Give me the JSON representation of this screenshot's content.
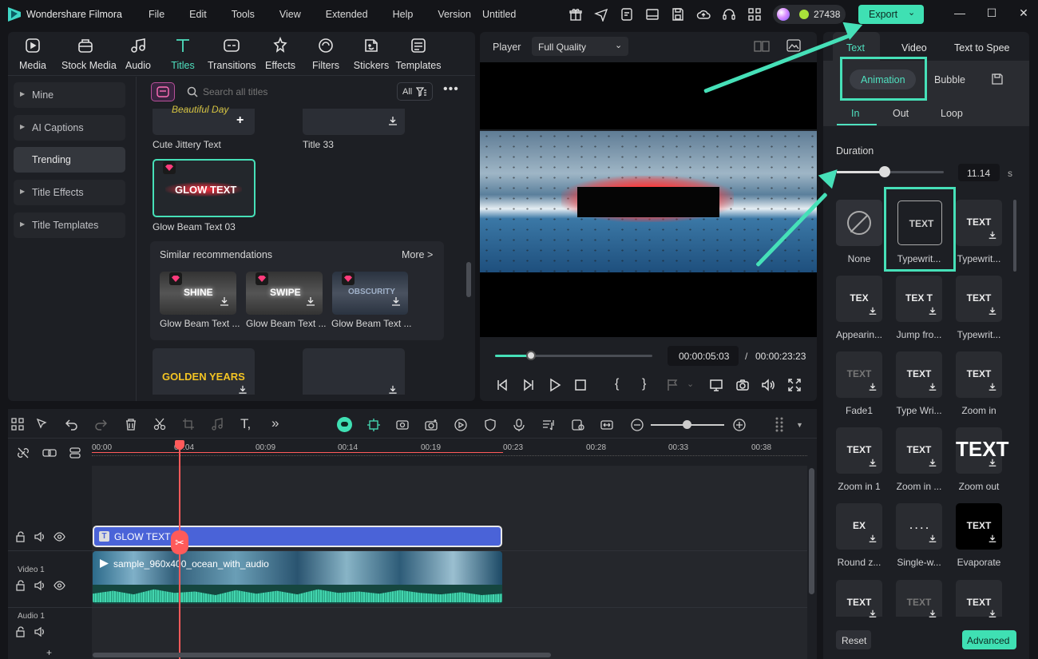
{
  "app": {
    "name": "Wondershare Filmora",
    "doc_title": "Untitled",
    "credits": "27438",
    "export_label": "Export"
  },
  "menu": [
    "File",
    "Edit",
    "Tools",
    "View",
    "Extended",
    "Help",
    "Version"
  ],
  "toolbar": [
    {
      "label": "Media",
      "icon": "media-icon"
    },
    {
      "label": "Stock Media",
      "icon": "stock-media-icon"
    },
    {
      "label": "Audio",
      "icon": "audio-icon"
    },
    {
      "label": "Titles",
      "icon": "titles-icon",
      "active": true
    },
    {
      "label": "Transitions",
      "icon": "transitions-icon"
    },
    {
      "label": "Effects",
      "icon": "effects-icon"
    },
    {
      "label": "Filters",
      "icon": "filters-icon"
    },
    {
      "label": "Stickers",
      "icon": "stickers-icon"
    },
    {
      "label": "Templates",
      "icon": "templates-icon"
    }
  ],
  "sidebar": [
    {
      "label": "Mine",
      "arrow": true
    },
    {
      "label": "AI Captions",
      "arrow": true
    },
    {
      "label": "Trending",
      "arrow": false,
      "active": true
    },
    {
      "label": "Title Effects",
      "arrow": true
    },
    {
      "label": "Title Templates",
      "arrow": true
    }
  ],
  "library": {
    "search_placeholder": "Search all titles",
    "filter_label": "All",
    "thumb_top_left_text": "Beautiful Day",
    "items": [
      {
        "caption": "Cute Jittery Text"
      },
      {
        "caption": "Title 33"
      },
      {
        "caption": "Glow Beam Text 03",
        "thumb_text": "GLOW TEXT"
      }
    ],
    "similar": {
      "title": "Similar recommendations",
      "more": "More >",
      "items": [
        {
          "caption": "Glow Beam Text ...",
          "thumb_text": "SHINE"
        },
        {
          "caption": "Glow Beam Text ...",
          "thumb_text": "SWIPE"
        },
        {
          "caption": "Glow Beam Text ...",
          "thumb_text": "OBSCURITY"
        }
      ]
    },
    "bottom_thumb_text": "GOLDEN YEARS"
  },
  "player": {
    "label": "Player",
    "quality": "Full Quality",
    "current": "00:00:05:03",
    "total": "00:00:23:23",
    "progress": 0.2,
    "separator": "/"
  },
  "right": {
    "tabs": [
      "Text",
      "Video",
      "Text to Spee"
    ],
    "subtabs": [
      "Animation",
      "Bubble"
    ],
    "mode_tabs": [
      "In",
      "Out",
      "Loop"
    ],
    "duration_label": "Duration",
    "duration_value": "11.14",
    "duration_unit": "s",
    "duration_fraction": 0.45,
    "animations": [
      {
        "label": "None",
        "glyph": ""
      },
      {
        "label": "Typewrit...",
        "glyph": "TEXT"
      },
      {
        "label": "Typewrit...",
        "glyph": "TEXT"
      },
      {
        "label": "Appearin...",
        "glyph": "TEX"
      },
      {
        "label": "Jump fro...",
        "glyph": "TEX T"
      },
      {
        "label": "Typewrit...",
        "glyph": "TEXT"
      },
      {
        "label": "Fade1",
        "glyph": "TEXT"
      },
      {
        "label": "Type Wri...",
        "glyph": "TEXT"
      },
      {
        "label": "Zoom in",
        "glyph": "TEXT"
      },
      {
        "label": "Zoom in 1",
        "glyph": "TEXT"
      },
      {
        "label": "Zoom in ...",
        "glyph": "TEXT"
      },
      {
        "label": "Zoom out",
        "glyph": "TEXT"
      },
      {
        "label": "Round z...",
        "glyph": "EX"
      },
      {
        "label": "Single-w...",
        "glyph": ". . . ."
      },
      {
        "label": "Evaporate",
        "glyph": "TEXT"
      },
      {
        "label": "",
        "glyph": "TEXT"
      },
      {
        "label": "",
        "glyph": "TEXT"
      },
      {
        "label": "",
        "glyph": "TEXT"
      }
    ],
    "reset": "Reset",
    "advanced": "Advanced"
  },
  "timeline": {
    "ruler": [
      "00:00",
      "00:04",
      "00:09",
      "00:14",
      "00:19",
      "00:23",
      "00:28",
      "00:33",
      "00:38"
    ],
    "title_clip": "GLOW TEXT",
    "video_clip": "sample_960x400_ocean_with_audio",
    "track_video": "Video 1",
    "track_audio": "Audio 1"
  },
  "colors": {
    "accent": "#46e0b8",
    "title_clip": "#4a63d8",
    "playhead": "#ff5a5a"
  }
}
